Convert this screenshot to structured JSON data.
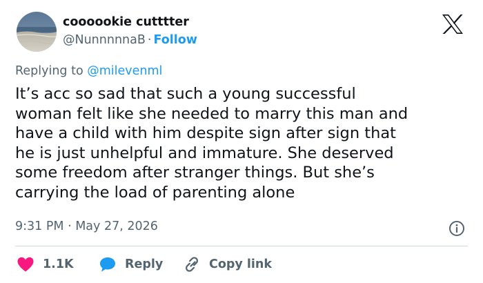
{
  "author": {
    "display_name": "coooookie cutttter",
    "handle": "@NunnnnnaB",
    "separator": "·",
    "follow_label": "Follow"
  },
  "reply_context": {
    "prefix": "Replying to",
    "handle": "@milevenml"
  },
  "tweet": {
    "text": "It’s acc so sad that such a young successful\nwoman felt like she needed to marry this man and\nhave a child with him despite sign after sign that\nhe is just unhelpful and immature. She deserved\nsome freedom after stranger things. But she’s\ncarrying the load of parenting alone",
    "timestamp": "9:31 PM · May 27, 2026"
  },
  "actions": {
    "like_count": "1.1K",
    "reply_label": "Reply",
    "copy_link_label": "Copy link"
  },
  "icons": {
    "logo": "x-logo-icon",
    "info": "info-icon",
    "like": "heart-icon",
    "reply": "speech-bubble-icon",
    "copy": "link-icon"
  },
  "colors": {
    "text": "#0f1419",
    "secondary": "#536471",
    "link": "#1d9bf0",
    "like": "#f91880",
    "divider": "#cfd9de"
  }
}
